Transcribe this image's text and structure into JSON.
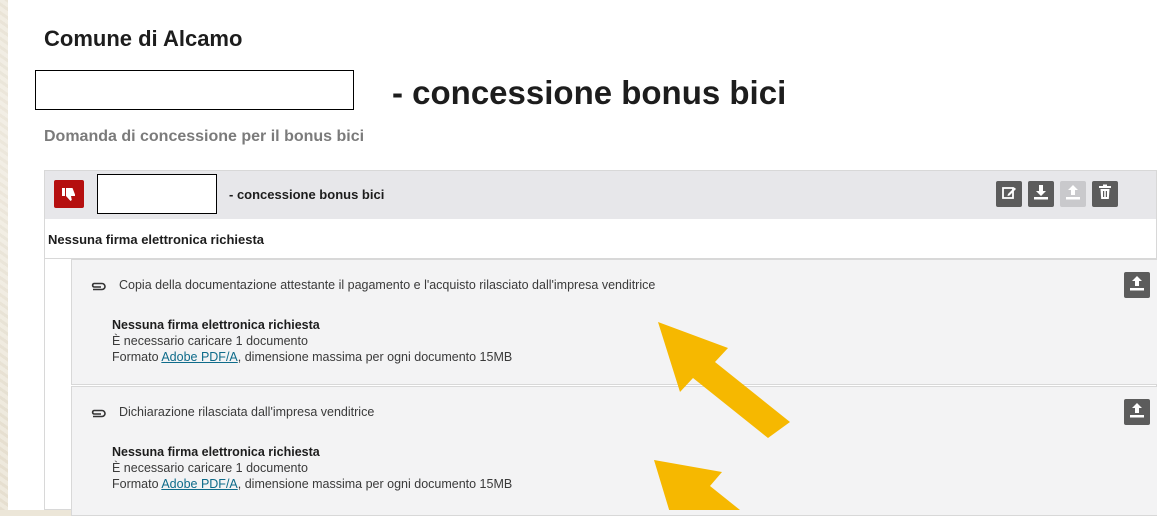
{
  "header": {
    "org_name": "Comune di Alcamo",
    "title": "- concessione bonus bici",
    "subtitle": "Domanda di concessione per il bonus bici"
  },
  "document_panel": {
    "title": "- concessione bonus bici",
    "status_icon": "thumbs-down-icon",
    "signature_note": "Nessuna firma elettronica richiesta",
    "tools": [
      "edit-icon",
      "download-icon",
      "upload-icon",
      "trash-icon"
    ]
  },
  "requirements": [
    {
      "title": "Copia della documentazione attestante il pagamento e l'acquisto rilasciato dall'impresa venditrice",
      "signature": "Nessuna firma elettronica richiesta",
      "count": "È necessario caricare 1 documento",
      "format_prefix": "Formato ",
      "format_link": "Adobe PDF/A",
      "format_suffix": ", dimensione massima per ogni documento 15MB"
    },
    {
      "title": "Dichiarazione rilasciata dall'impresa venditrice",
      "signature": "Nessuna firma elettronica richiesta",
      "count": "È necessario caricare 1 documento",
      "format_prefix": "Formato ",
      "format_link": "Adobe PDF/A",
      "format_suffix": ", dimensione massima per ogni documento 15MB"
    }
  ],
  "colors": {
    "badge_red": "#b50f0f",
    "button_gray": "#5c5c5c",
    "arrow_yellow": "#f6b800",
    "link_teal": "#0e6b8a"
  }
}
